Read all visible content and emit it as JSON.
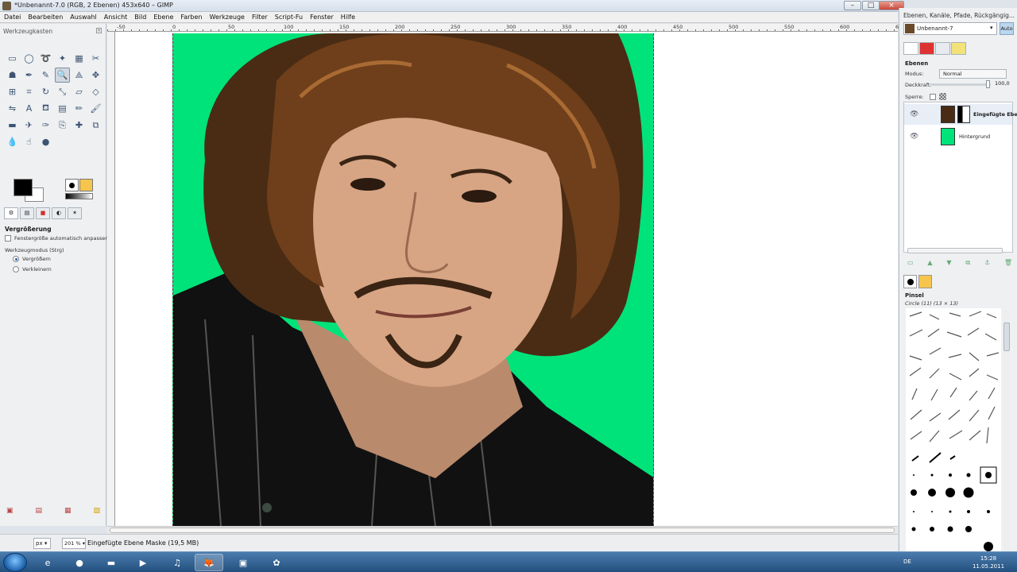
{
  "window": {
    "title": "*Unbenannt-7.0 (RGB, 2 Ebenen) 453x640 – GIMP",
    "minimize": "–",
    "maximize": "□",
    "close": "×"
  },
  "menu": [
    "Datei",
    "Bearbeiten",
    "Auswahl",
    "Ansicht",
    "Bild",
    "Ebene",
    "Farben",
    "Werkzeuge",
    "Filter",
    "Script-Fu",
    "Fenster",
    "Hilfe"
  ],
  "toolbox": {
    "title": "Werkzeugkasten",
    "tools": [
      {
        "name": "rect-select-icon",
        "glyph": "▭"
      },
      {
        "name": "ellipse-select-icon",
        "glyph": "◯"
      },
      {
        "name": "free-select-icon",
        "glyph": "➰"
      },
      {
        "name": "fuzzy-select-icon",
        "glyph": "✦"
      },
      {
        "name": "color-select-icon",
        "glyph": "▦"
      },
      {
        "name": "scissors-icon",
        "glyph": "✂"
      },
      {
        "name": "foreground-select-icon",
        "glyph": "☗"
      },
      {
        "name": "paths-icon",
        "glyph": "✒"
      },
      {
        "name": "color-picker-icon",
        "glyph": "✎"
      },
      {
        "name": "zoom-icon",
        "glyph": "🔍"
      },
      {
        "name": "measure-icon",
        "glyph": "⟁"
      },
      {
        "name": "move-icon",
        "glyph": "✥"
      },
      {
        "name": "align-icon",
        "glyph": "⊞"
      },
      {
        "name": "crop-icon",
        "glyph": "⌗"
      },
      {
        "name": "rotate-icon",
        "glyph": "↻"
      },
      {
        "name": "scale-icon",
        "glyph": "⤡"
      },
      {
        "name": "shear-icon",
        "glyph": "▱"
      },
      {
        "name": "perspective-icon",
        "glyph": "◇"
      },
      {
        "name": "flip-icon",
        "glyph": "⇋"
      },
      {
        "name": "text-icon",
        "glyph": "A"
      },
      {
        "name": "bucket-fill-icon",
        "glyph": "⛾"
      },
      {
        "name": "blend-icon",
        "glyph": "▤"
      },
      {
        "name": "pencil-icon",
        "glyph": "✏"
      },
      {
        "name": "paintbrush-icon",
        "glyph": "🖌"
      },
      {
        "name": "eraser-icon",
        "glyph": "▬"
      },
      {
        "name": "airbrush-icon",
        "glyph": "✈"
      },
      {
        "name": "ink-icon",
        "glyph": "✑"
      },
      {
        "name": "clone-icon",
        "glyph": "⎘"
      },
      {
        "name": "heal-icon",
        "glyph": "✚"
      },
      {
        "name": "perspective-clone-icon",
        "glyph": "⧉"
      },
      {
        "name": "blur-icon",
        "glyph": "💧"
      },
      {
        "name": "smudge-icon",
        "glyph": "☝"
      },
      {
        "name": "dodge-burn-icon",
        "glyph": "●"
      }
    ],
    "options": {
      "title": "Vergrößerung",
      "auto_resize": "Fenstergröße automatisch anpassen",
      "mode_label": "Werkzeugmodus (Strg)",
      "zoom_in": "Vergrößern",
      "zoom_out": "Verkleinern"
    }
  },
  "ruler": {
    "labels": [
      "-50",
      "0",
      "50",
      "100",
      "150",
      "200",
      "250",
      "300",
      "350",
      "400",
      "450",
      "500",
      "550",
      "600",
      "650",
      "700"
    ]
  },
  "status": {
    "unit": "px",
    "zoom": "201 %",
    "message": "Eingefügte Ebene Maske (19,5 MB)"
  },
  "dock": {
    "title": "Ebenen, Kanäle, Pfade, Rückgängig...",
    "image_name": "Unbenannt-7",
    "auto": "Auto",
    "layers_title": "Ebenen",
    "mode_label": "Modus:",
    "mode_value": "Normal",
    "opacity_label": "Deckkraft:",
    "opacity_value": "100,0",
    "lock_label": "Sperre:",
    "layers": [
      {
        "name": "Eingefügte Ebene",
        "selected": true
      },
      {
        "name": "Hintergrund",
        "selected": false
      }
    ],
    "brushes_title": "Pinsel",
    "brush_info": "Circle (11) (13 × 13)"
  },
  "taskbar": {
    "language": "DE",
    "time": "15:28",
    "date": "11.05.2011"
  },
  "colors": {
    "canvas_bg": "#00e37a",
    "accent": "#2a5ea8"
  }
}
